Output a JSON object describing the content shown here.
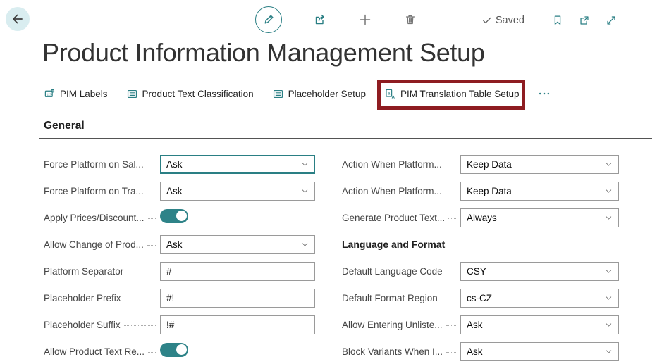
{
  "colors": {
    "accent_teal": "#2a7f84",
    "toggle_on": "#2e8388",
    "highlight_red": "#8e1c21",
    "back_circle": "#d9edf0"
  },
  "toolbar": {
    "back": {
      "name": "back-button",
      "icon": "back-arrow-icon"
    },
    "center": [
      {
        "name": "edit-button",
        "icon": "pencil-icon",
        "circled": true
      },
      {
        "name": "share-button",
        "icon": "share-icon",
        "circled": false
      },
      {
        "name": "add-button",
        "icon": "plus-icon",
        "circled": false
      },
      {
        "name": "delete-button",
        "icon": "trash-icon",
        "circled": false
      }
    ],
    "status": {
      "icon": "check-icon",
      "label": "Saved"
    },
    "right": [
      {
        "name": "bookmark-button",
        "icon": "bookmark-icon"
      },
      {
        "name": "open-in-new-window-button",
        "icon": "open-window-icon"
      },
      {
        "name": "expand-button",
        "icon": "expand-icon"
      }
    ]
  },
  "page": {
    "title": "Product Information Management Setup"
  },
  "action_bar": {
    "items": [
      {
        "label": "PIM Labels",
        "icon": "pim-labels-icon",
        "highlighted": false
      },
      {
        "label": "Product Text Classification",
        "icon": "list-icon",
        "highlighted": false
      },
      {
        "label": "Placeholder Setup",
        "icon": "list-icon",
        "highlighted": false
      },
      {
        "label": "PIM Translation Table Setup",
        "icon": "translate-icon",
        "highlighted": true
      }
    ],
    "more": {
      "name": "more-actions-button",
      "icon": "ellipsis-icon"
    }
  },
  "section": {
    "title": "General"
  },
  "form": {
    "left": [
      {
        "label": "Force Platform on Sal...",
        "type": "select",
        "value": "Ask",
        "focused": true
      },
      {
        "label": "Force Platform on Tra...",
        "type": "select",
        "value": "Ask",
        "focused": false
      },
      {
        "label": "Apply Prices/Discount...",
        "type": "toggle",
        "value": true
      },
      {
        "label": "Allow Change of Prod...",
        "type": "select",
        "value": "Ask",
        "focused": false
      },
      {
        "label": "Platform Separator",
        "type": "text",
        "value": "#"
      },
      {
        "label": "Placeholder Prefix",
        "type": "text",
        "value": "#!"
      },
      {
        "label": "Placeholder Suffix",
        "type": "text",
        "value": "!#"
      },
      {
        "label": "Allow Product Text Re...",
        "type": "toggle",
        "value": true
      }
    ],
    "right": [
      {
        "label": "Action When Platform...",
        "type": "select",
        "value": "Keep Data",
        "focused": false
      },
      {
        "label": "Action When Platform...",
        "type": "select",
        "value": "Keep Data",
        "focused": false
      },
      {
        "label": "Generate Product Text...",
        "type": "select",
        "value": "Always",
        "focused": false
      },
      {
        "label": "Language and Format",
        "type": "subheader"
      },
      {
        "label": "Default Language Code",
        "type": "select",
        "value": "CSY",
        "focused": false
      },
      {
        "label": "Default Format Region",
        "type": "select",
        "value": "cs-CZ",
        "focused": false
      },
      {
        "label": "Allow Entering Unliste...",
        "type": "select",
        "value": "Ask",
        "focused": false
      },
      {
        "label": "Block Variants When I...",
        "type": "select",
        "value": "Ask",
        "focused": false
      }
    ]
  }
}
